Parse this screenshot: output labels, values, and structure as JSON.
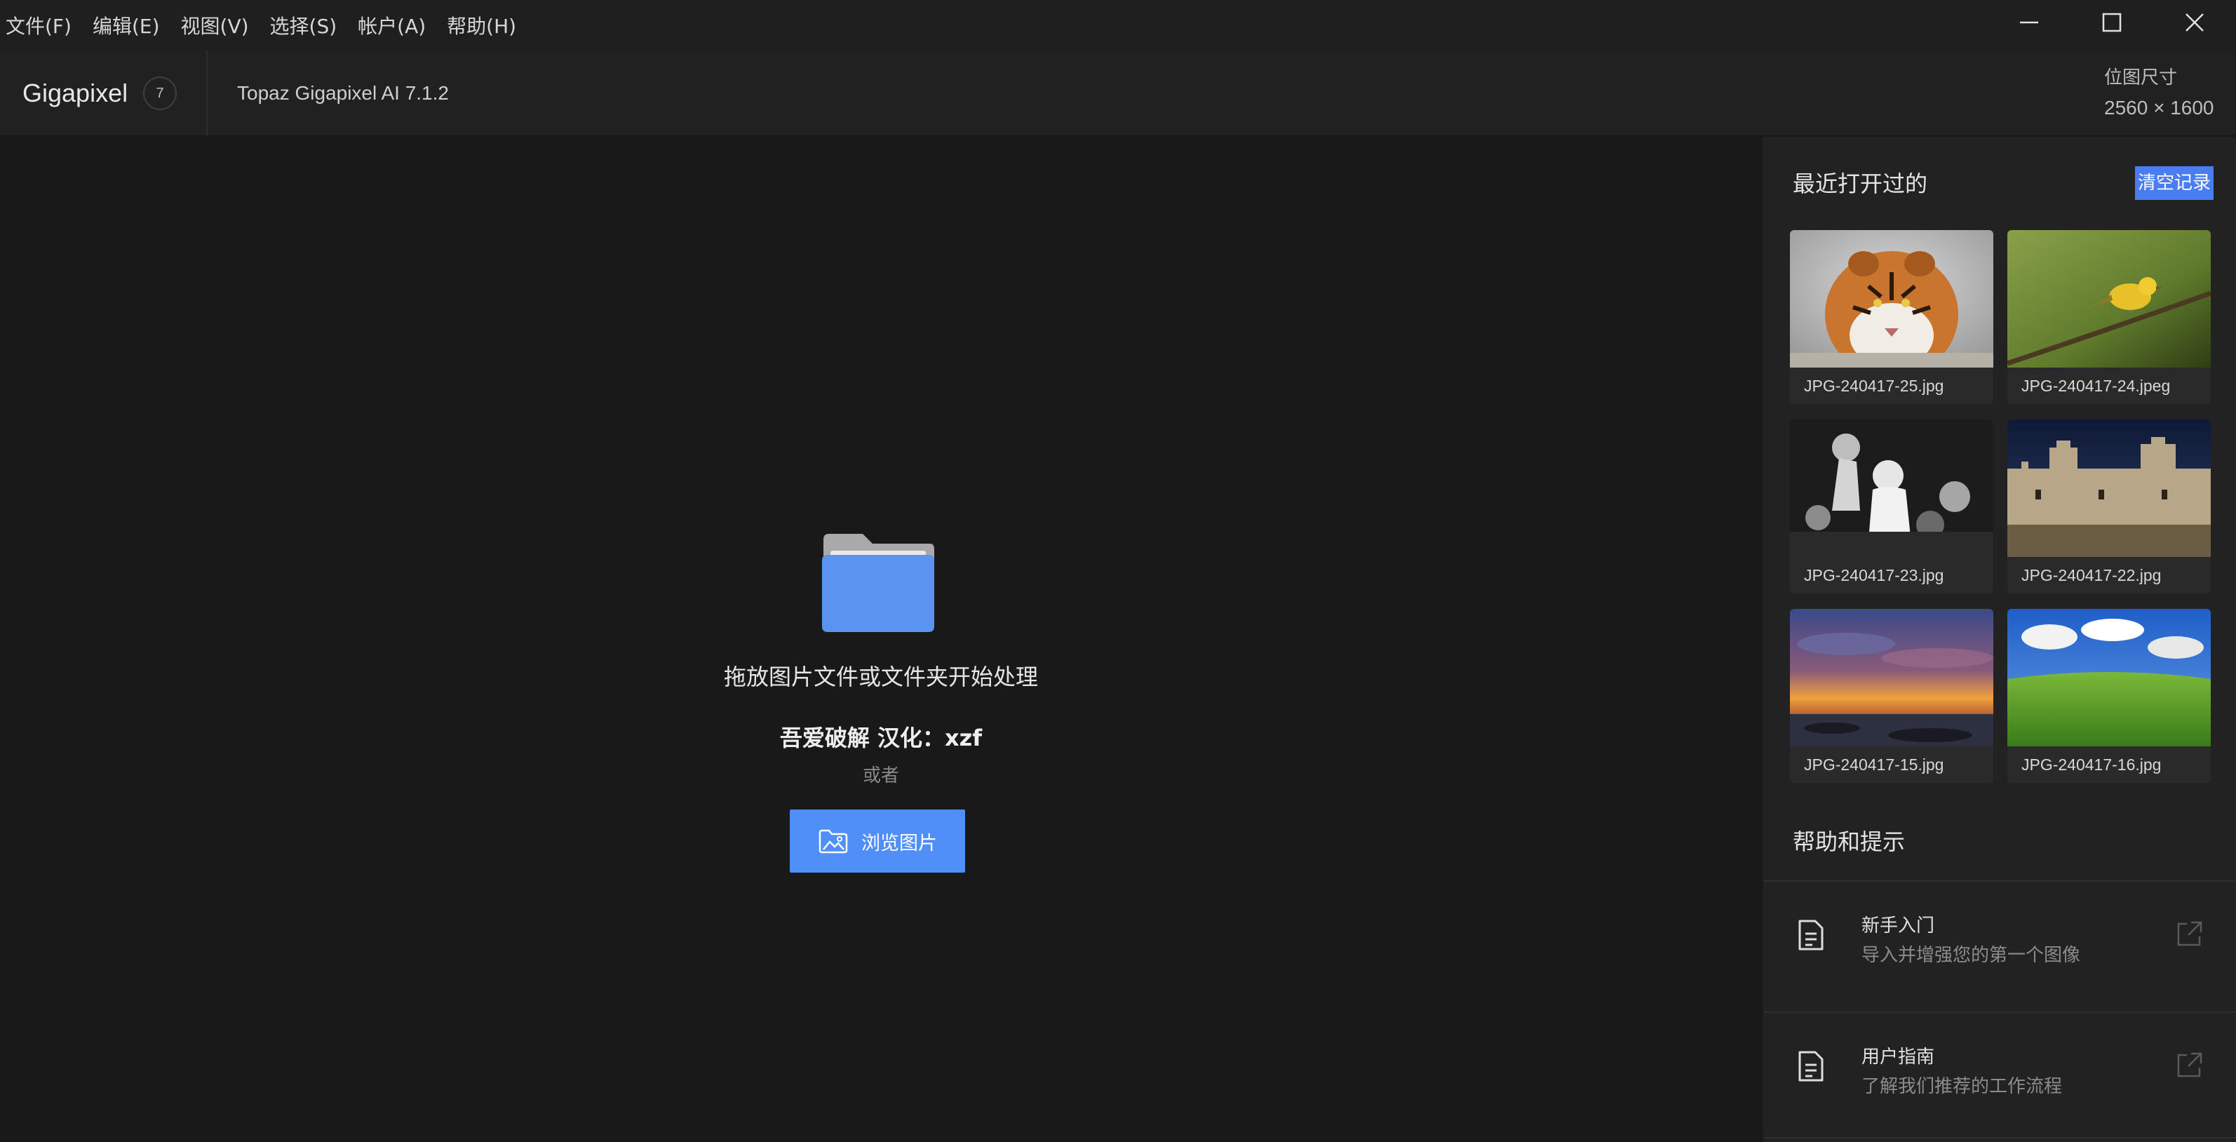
{
  "menu": {
    "items": [
      "文件(F)",
      "编辑(E)",
      "视图(V)",
      "选择(S)",
      "帐户(A)",
      "帮助(H)"
    ]
  },
  "window_controls": {
    "minimize_icon": "minimize-icon",
    "maximize_icon": "maximize-icon",
    "close_icon": "close-icon"
  },
  "header": {
    "brand": "Gigapixel",
    "version_badge": "7",
    "app_title": "Topaz Gigapixel AI 7.1.2",
    "bitmap_label": "位图尺寸",
    "bitmap_size": "2560 × 1600"
  },
  "main": {
    "drop_hint": "拖放图片文件或文件夹开始处理",
    "credit": "吾爱破解  汉化：xzf",
    "or": "或者",
    "browse_label": "浏览图片",
    "accent_color": "#4f8ff7"
  },
  "recent": {
    "title": "最近打开过的",
    "clear_label": "清空记录",
    "files": [
      {
        "name": "JPG-240417-25.jpg",
        "subject": "tiger"
      },
      {
        "name": "JPG-240417-24.jpeg",
        "subject": "yellow-bird"
      },
      {
        "name": "JPG-240417-23.jpg",
        "subject": "black-white-crowd"
      },
      {
        "name": "JPG-240417-22.jpg",
        "subject": "castle-night"
      },
      {
        "name": "JPG-240417-15.jpg",
        "subject": "sunset-sea"
      },
      {
        "name": "JPG-240417-16.jpg",
        "subject": "green-field-sky"
      }
    ]
  },
  "help": {
    "title": "帮助和提示",
    "items": [
      {
        "title": "新手入门",
        "desc": "导入并增强您的第一个图像"
      },
      {
        "title": "用户指南",
        "desc": "了解我们推荐的工作流程"
      }
    ]
  }
}
